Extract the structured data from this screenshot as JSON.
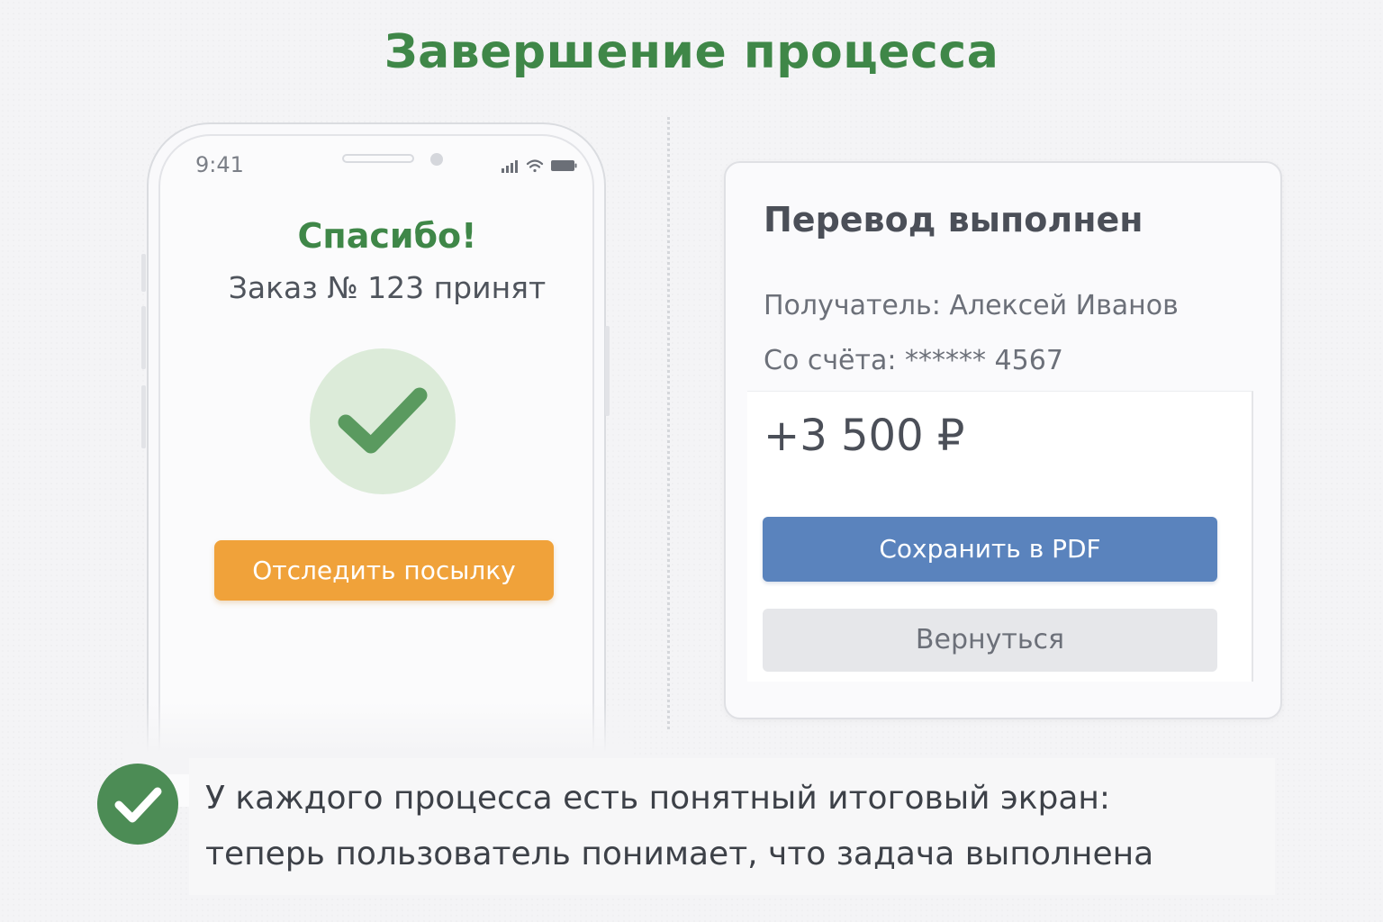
{
  "page": {
    "title": "Завершение процесса"
  },
  "phone": {
    "status_time": "9:41",
    "heading": "Спасибо!",
    "order_text": "Заказ № 123 принят",
    "track_button_label": "Отследить посылку",
    "icons": {
      "signal": "signal-icon",
      "wifi": "wifi-icon",
      "battery": "battery-icon",
      "check": "checkmark-icon"
    }
  },
  "transfer_card": {
    "title": "Перевод выполнен",
    "recipient": "Получатель: Алексей Иванов",
    "account": "Со счёта: ****** 4567",
    "amount": "+3 500 ₽",
    "save_button_label": "Сохранить в PDF",
    "back_button_label": "Вернуться"
  },
  "note": {
    "line1": "У каждого процесса есть понятный итоговый экран:",
    "line2": "теперь пользователь понимает, что задача выполнена",
    "icon": "checkmark-circle-icon"
  },
  "colors": {
    "brand_green": "#3f8748",
    "accent_orange": "#f0a23a",
    "primary_blue": "#5a83bd",
    "secondary_gray": "#e6e7ea",
    "success_light": "#dcebd9"
  }
}
